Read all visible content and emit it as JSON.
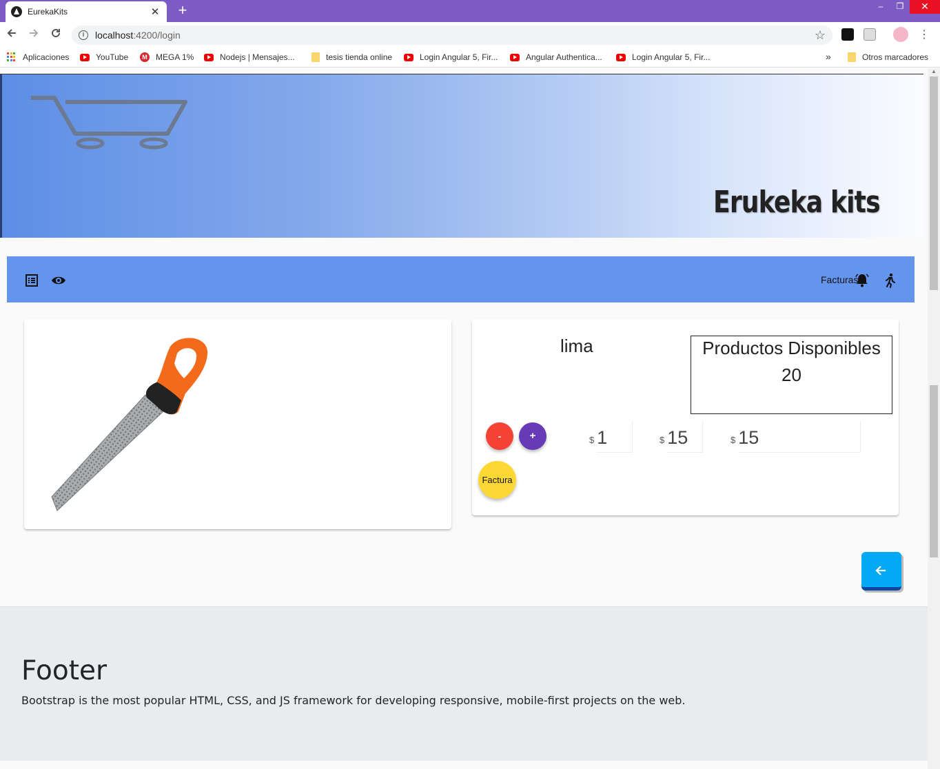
{
  "browser": {
    "tab_title": "EurekaKits",
    "new_tab_symbol": "+",
    "tab_close_symbol": "✕",
    "url_host": "localhost",
    "url_path": ":4200/login",
    "window_controls": {
      "minimize": "–",
      "restore": "❐",
      "close": "✕"
    }
  },
  "bookmarks": {
    "items": [
      {
        "label": "Aplicaciones",
        "icon": "apps-icon"
      },
      {
        "label": "YouTube",
        "icon": "youtube-icon"
      },
      {
        "label": "MEGA 1%",
        "icon": "mega-icon"
      },
      {
        "label": "Nodejs | Mensajes...",
        "icon": "youtube-icon"
      },
      {
        "label": "tesis tienda online",
        "icon": "folder-icon"
      },
      {
        "label": "Login Angular 5, Fir...",
        "icon": "youtube-icon"
      },
      {
        "label": "Angular Authentica...",
        "icon": "youtube-icon"
      },
      {
        "label": "Login Angular 5, Fir...",
        "icon": "youtube-icon"
      }
    ],
    "overflow": "»",
    "other": "Otros marcadores"
  },
  "banner": {
    "brand": "Erukeka kits"
  },
  "navbar": {
    "facturas_label": "Facturas"
  },
  "product": {
    "name": "lima",
    "stock_title": "Productos Disponibles",
    "stock_count": "20",
    "minus_label": "-",
    "plus_label": "+",
    "factura_label": "Factura",
    "currency_symbol": "$",
    "quantity": "1",
    "unit_price": "15",
    "total": "15"
  },
  "footer": {
    "title": "Footer",
    "text": "Bootstrap is the most popular HTML, CSS, and JS framework for developing responsive, mobile-first projects on the web."
  },
  "colors": {
    "tab_strip": "#7c5cc4",
    "navbar": "#6495ed",
    "minus_button": "#f44336",
    "plus_button": "#673ab7",
    "factura_button": "#fdd835",
    "back_button": "#03a9f4",
    "footer_bg": "#e9ecef"
  }
}
